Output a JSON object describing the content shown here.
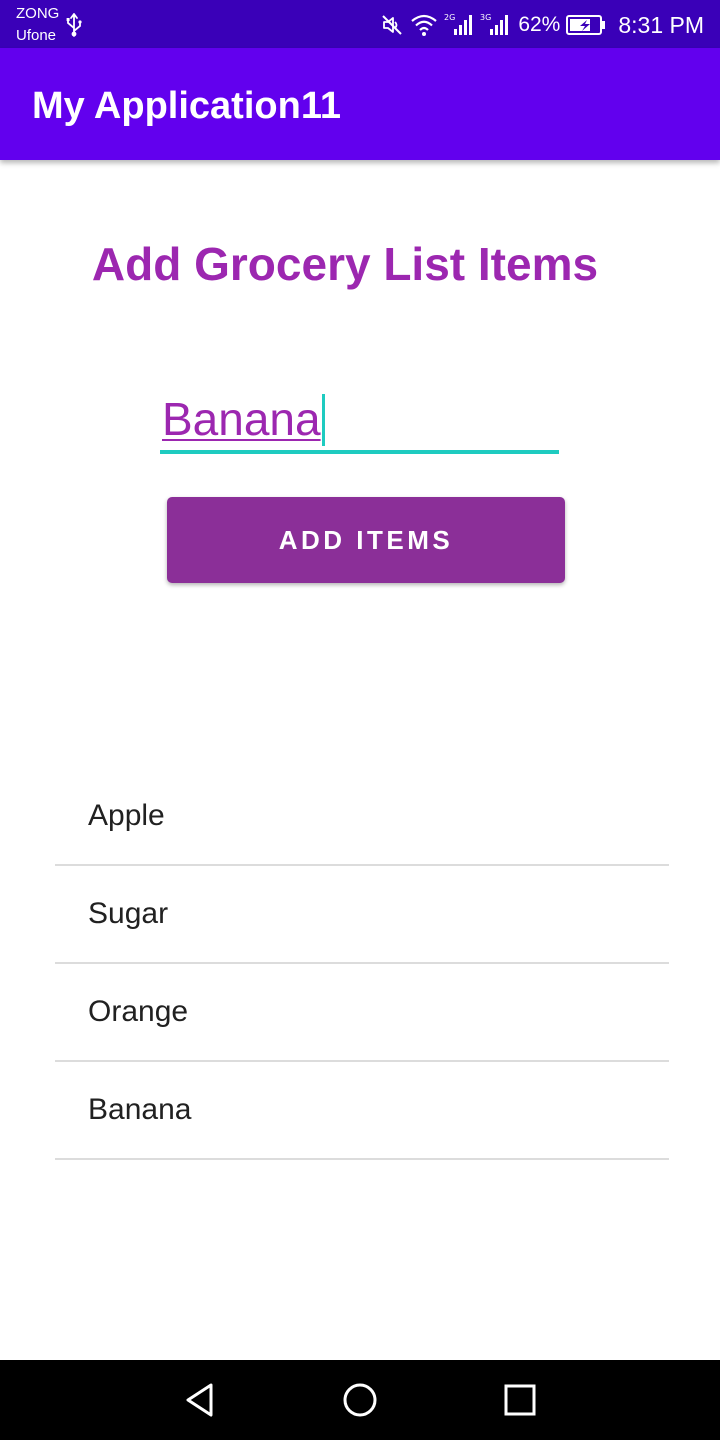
{
  "status_bar": {
    "carrier_1": "ZONG",
    "carrier_2": "Ufone",
    "network_1": "2G",
    "network_2": "3G",
    "battery": "62%",
    "time": "8:31 PM",
    "icons": [
      "usb-icon",
      "mute-icon",
      "wifi-icon",
      "signal-icon",
      "signal-icon",
      "battery-charging-icon"
    ],
    "background_color": "#3a00b8"
  },
  "app_bar": {
    "title": "My Application11",
    "background_color": "#6200ee"
  },
  "main": {
    "heading": "Add Grocery List Items",
    "input": {
      "value": "Banana",
      "placeholder": ""
    },
    "add_button_label": "ADD ITEMS",
    "accent_color": "#9c27b0",
    "focus_line_color": "#1ecbc0",
    "button_color": "#8b2f98"
  },
  "grocery_items": [
    "Apple",
    "Sugar",
    "Orange",
    "Banana"
  ],
  "nav_bar": {
    "icons": [
      "back-icon",
      "home-icon",
      "recents-icon"
    ]
  }
}
